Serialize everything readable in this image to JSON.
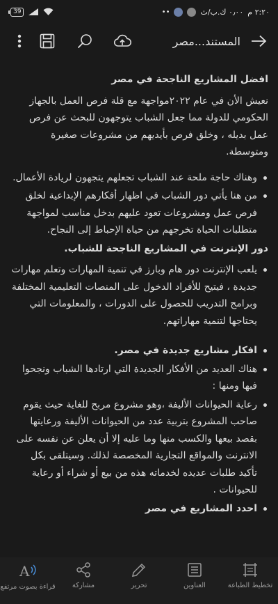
{
  "status_bar": {
    "time": "٢:٢٠ م",
    "network_speed": "٠٫٠٠ ك.ب/ث",
    "battery_level": "39"
  },
  "app_bar": {
    "title": "المستند...مصر"
  },
  "document": {
    "heading_1": "افضل المشاريع الناجحة في مصر",
    "intro": "نعيش الأن في عام ٢٠٢٢مواجهة مع قلة فرص العمل بالجهاز الحكومي للدولة مما جعل الشباب يتوجهون للبحث عن فرص عمل بديله ، وخلق فرص بأيديهم من مشروعات صغيرة ومتوسطة.",
    "bullets_1": [
      "وهناك حاجة ملحة عند الشباب تجعلهم يتجهون لريادة الأعمال.",
      "من هنا يأتي دور الشباب في اظهار أفكارهم الإبداعية لخلق فرص عمل ومشروعات تعود عليهم بدخل مناسب لمواجهة متطلبات الحياة تخرجهم من حياة الإحباط إلى النجاح."
    ],
    "heading_2": "دور الإنترنت في المشاريع الناجحة للشباب.",
    "bullets_2": [
      "يلعب الإنترنت دور هام وبارز في تنمية المهارات وتعلم مهارات جديدة ، فيتيح للأفراد الدخول على المنصات التعليمية المختلفة وبرامج التدريب للحصول على الدورات ، والمعلومات التي يحتاجها لتنمية مهاراتهم."
    ],
    "heading_3": "افكار مشاريع جديدة في مصر.",
    "bullets_3": [
      "هناك العديد من الأفكار الجديدة التي ارتادها الشباب ونجحوا فيها ومنها :",
      "رعاية الحيوانات الأليفة ،وهو مشروع مربح للغاية حيث يقوم صاحب المشروع بتربية عدد من الحيوانات الأليفة ورعايتها بقصد بيعها والكسب منها وما عليه إلا أن يعلن عن نفسه على الانترنت والمواقع التجارية المخصصة لذلك. وسيتلقى بكل تأكيد طلبات عديده لخدماته هذه من بيع أو شراء أو رعاية للحيوانات .",
      "احدد المشاريع في مصر"
    ]
  },
  "bottom_bar": {
    "items": [
      {
        "label": "تخطيط الطباعة",
        "icon": "print-layout-icon"
      },
      {
        "label": "العناوين",
        "icon": "headings-icon"
      },
      {
        "label": "تحرير",
        "icon": "edit-pencil-icon"
      },
      {
        "label": "مشاركة",
        "icon": "share-icon"
      },
      {
        "label": "قراءة بصوت مرتفع",
        "icon": "read-aloud-icon"
      }
    ]
  }
}
